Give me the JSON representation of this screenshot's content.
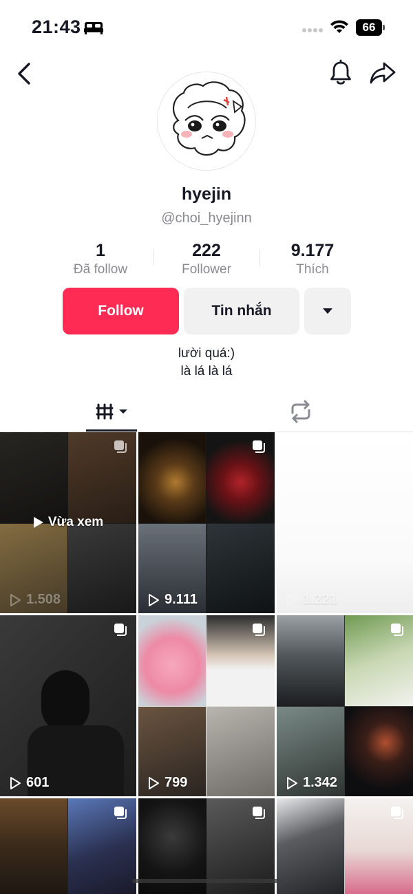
{
  "status_bar": {
    "time": "21:43",
    "battery": "66"
  },
  "profile": {
    "display_name": "hyejin",
    "username": "@choi_hyejinn",
    "stats": [
      {
        "value": "1",
        "label": "Đã follow"
      },
      {
        "value": "222",
        "label": "Follower"
      },
      {
        "value": "9.177",
        "label": "Thích"
      }
    ],
    "buttons": {
      "follow": "Follow",
      "message": "Tin nhắn"
    },
    "bio": [
      "lười quá:)",
      "là lá là lá"
    ]
  },
  "colors": {
    "accent": "#fe2c55",
    "secondary_button": "#f1f1f2",
    "muted_text": "#8a8b91"
  },
  "grid": {
    "watched_label": "Vừa xem",
    "counts": [
      "1.508",
      "9.111",
      "1.221",
      "601",
      "799",
      "1.342"
    ]
  }
}
